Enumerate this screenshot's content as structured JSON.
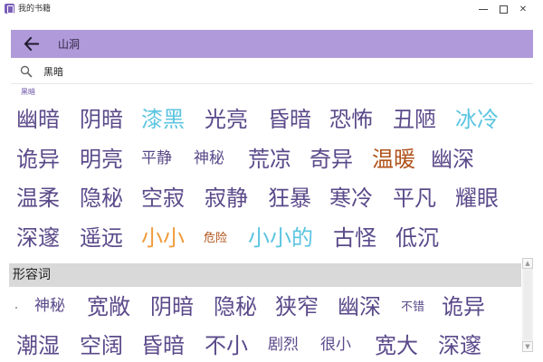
{
  "window": {
    "title": "我的书籍",
    "controls": {
      "minimize": "minimize",
      "maximize": "maximize",
      "close": "✕"
    }
  },
  "header": {
    "title": "山洞"
  },
  "search": {
    "value": "黑暗",
    "placeholder": ""
  },
  "section_tag": "黑暗",
  "words": [
    {
      "text": "幽暗",
      "color": "#5a4a8a",
      "size": "big"
    },
    {
      "text": "阴暗",
      "color": "#5a4a8a",
      "size": "big"
    },
    {
      "text": "漆黑",
      "color": "#5bc4e0",
      "size": "big"
    },
    {
      "text": "光亮",
      "color": "#5a4a8a",
      "size": "big"
    },
    {
      "text": "昏暗",
      "color": "#5a4a8a",
      "size": "big"
    },
    {
      "text": "恐怖",
      "color": "#5a4a8a",
      "size": "big"
    },
    {
      "text": "丑陋",
      "color": "#5a4a8a",
      "size": "big"
    },
    {
      "text": "冰冷",
      "color": "#5bc4e0",
      "size": "big"
    },
    {
      "text": "诡异",
      "color": "#5a4a8a",
      "size": "big"
    },
    {
      "text": "明亮",
      "color": "#5a4a8a",
      "size": "big"
    },
    {
      "text": "平静",
      "color": "#5a4a8a",
      "size": "small"
    },
    {
      "text": "神秘",
      "color": "#5a4a8a",
      "size": "small"
    },
    {
      "text": "荒凉",
      "color": "#5a4a8a",
      "size": "big"
    },
    {
      "text": "奇异",
      "color": "#5a4a8a",
      "size": "big"
    },
    {
      "text": "温暖",
      "color": "#b0531a",
      "size": "big"
    },
    {
      "text": "幽深",
      "color": "#5a4a8a",
      "size": "big"
    },
    {
      "text": "温柔",
      "color": "#5a4a8a",
      "size": "big"
    },
    {
      "text": "隐秘",
      "color": "#5a4a8a",
      "size": "big"
    },
    {
      "text": "空寂",
      "color": "#5a4a8a",
      "size": "big"
    },
    {
      "text": "寂静",
      "color": "#5a4a8a",
      "size": "big"
    },
    {
      "text": "狂暴",
      "color": "#5a4a8a",
      "size": "big"
    },
    {
      "text": "寒冷",
      "color": "#5a4a8a",
      "size": "big"
    },
    {
      "text": "平凡",
      "color": "#5a4a8a",
      "size": "big"
    },
    {
      "text": "耀眼",
      "color": "#5a4a8a",
      "size": "big"
    },
    {
      "text": "深邃",
      "color": "#5a4a8a",
      "size": "big"
    },
    {
      "text": "遥远",
      "color": "#5a4a8a",
      "size": "big"
    },
    {
      "text": "小小",
      "color": "#f09a3a",
      "size": "big"
    },
    {
      "text": "危险",
      "color": "#b0531a",
      "size": "tiny"
    },
    {
      "text": "小小的",
      "color": "#5bc4e0",
      "size": "big"
    },
    {
      "text": "古怪",
      "color": "#5a4a8a",
      "size": "big"
    },
    {
      "text": "低沉",
      "color": "#5a4a8a",
      "size": "big"
    }
  ],
  "adjectives": {
    "label": "形容词",
    "words": [
      {
        "text": "神秘",
        "color": "#5a4a8a",
        "size": "small"
      },
      {
        "text": "宽敞",
        "color": "#5a4a8a",
        "size": "big"
      },
      {
        "text": "阴暗",
        "color": "#5a4a8a",
        "size": "big"
      },
      {
        "text": "隐秘",
        "color": "#5a4a8a",
        "size": "big"
      },
      {
        "text": "狭窄",
        "color": "#5a4a8a",
        "size": "big"
      },
      {
        "text": "幽深",
        "color": "#5a4a8a",
        "size": "big"
      },
      {
        "text": "不错",
        "color": "#5a4a8a",
        "size": "tiny"
      },
      {
        "text": "诡异",
        "color": "#5a4a8a",
        "size": "big"
      },
      {
        "text": "潮湿",
        "color": "#5a4a8a",
        "size": "big"
      },
      {
        "text": "空阔",
        "color": "#5a4a8a",
        "size": "big"
      },
      {
        "text": "昏暗",
        "color": "#5a4a8a",
        "size": "big"
      },
      {
        "text": "不小",
        "color": "#5a4a8a",
        "size": "big"
      },
      {
        "text": "剧烈",
        "color": "#5a4a8a",
        "size": "small"
      },
      {
        "text": "很小",
        "color": "#5a4a8a",
        "size": "small"
      },
      {
        "text": "宽大",
        "color": "#5a4a8a",
        "size": "big"
      },
      {
        "text": "深邃",
        "color": "#5a4a8a",
        "size": "big"
      }
    ]
  }
}
